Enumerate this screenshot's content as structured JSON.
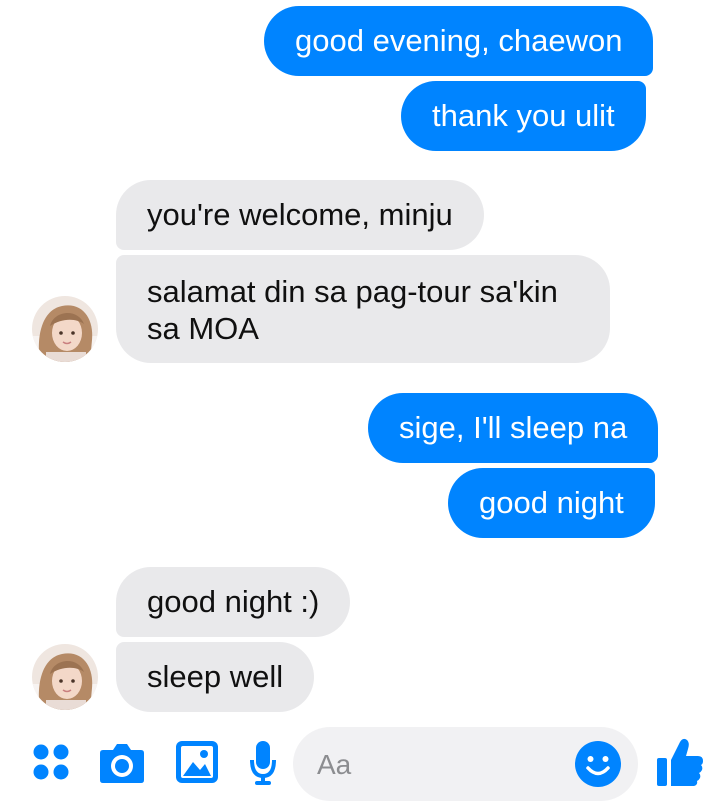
{
  "conversation": {
    "messages": [
      {
        "direction": "outgoing",
        "text": "good evening, chaewon"
      },
      {
        "direction": "outgoing",
        "text": "thank you ulit"
      },
      {
        "direction": "incoming",
        "text": "you're welcome, minju"
      },
      {
        "direction": "incoming",
        "lines": [
          "salamat din sa pag-tour sa'kin",
          "sa MOA"
        ]
      },
      {
        "direction": "outgoing",
        "text": "sige, I'll sleep na"
      },
      {
        "direction": "outgoing",
        "text": "good night"
      },
      {
        "direction": "incoming",
        "text": "good night :)"
      },
      {
        "direction": "incoming",
        "text": "sleep well"
      }
    ]
  },
  "composer": {
    "placeholder": "Aa",
    "icons": [
      "apps-icon",
      "camera-icon",
      "gallery-icon",
      "microphone-icon",
      "emoji-icon",
      "thumbs-up-icon"
    ]
  },
  "colors": {
    "accent": "#0084ff",
    "incoming_bubble": "#e9e9eb",
    "input_background": "#f1f1f3"
  }
}
